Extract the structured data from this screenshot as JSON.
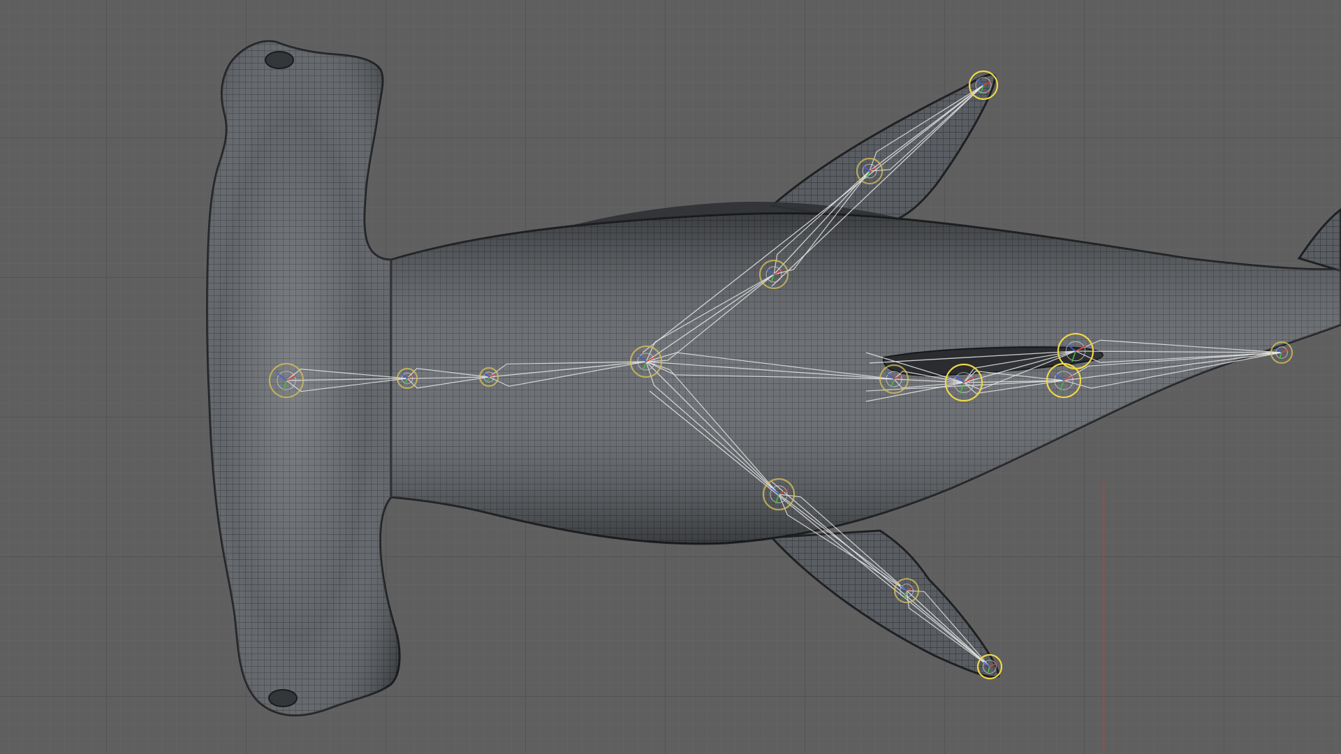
{
  "viewport": {
    "background": "#5f5f5f",
    "grid_minor_color": "#676767",
    "grid_major_color": "#4e4e4e",
    "axis_color": "#c83a3a"
  },
  "mesh": {
    "name": "hammerhead-shark",
    "fill_color": "#575b60",
    "wire_color": "#2a2c2f",
    "outline_color": "#202124"
  },
  "rig": {
    "bone_color": "#e6e6e6",
    "joint_color": "#d7c35a",
    "joint_active_color": "#f0d845",
    "gizmo_colors": [
      "#d84040",
      "#40c040",
      "#4060e0"
    ]
  }
}
